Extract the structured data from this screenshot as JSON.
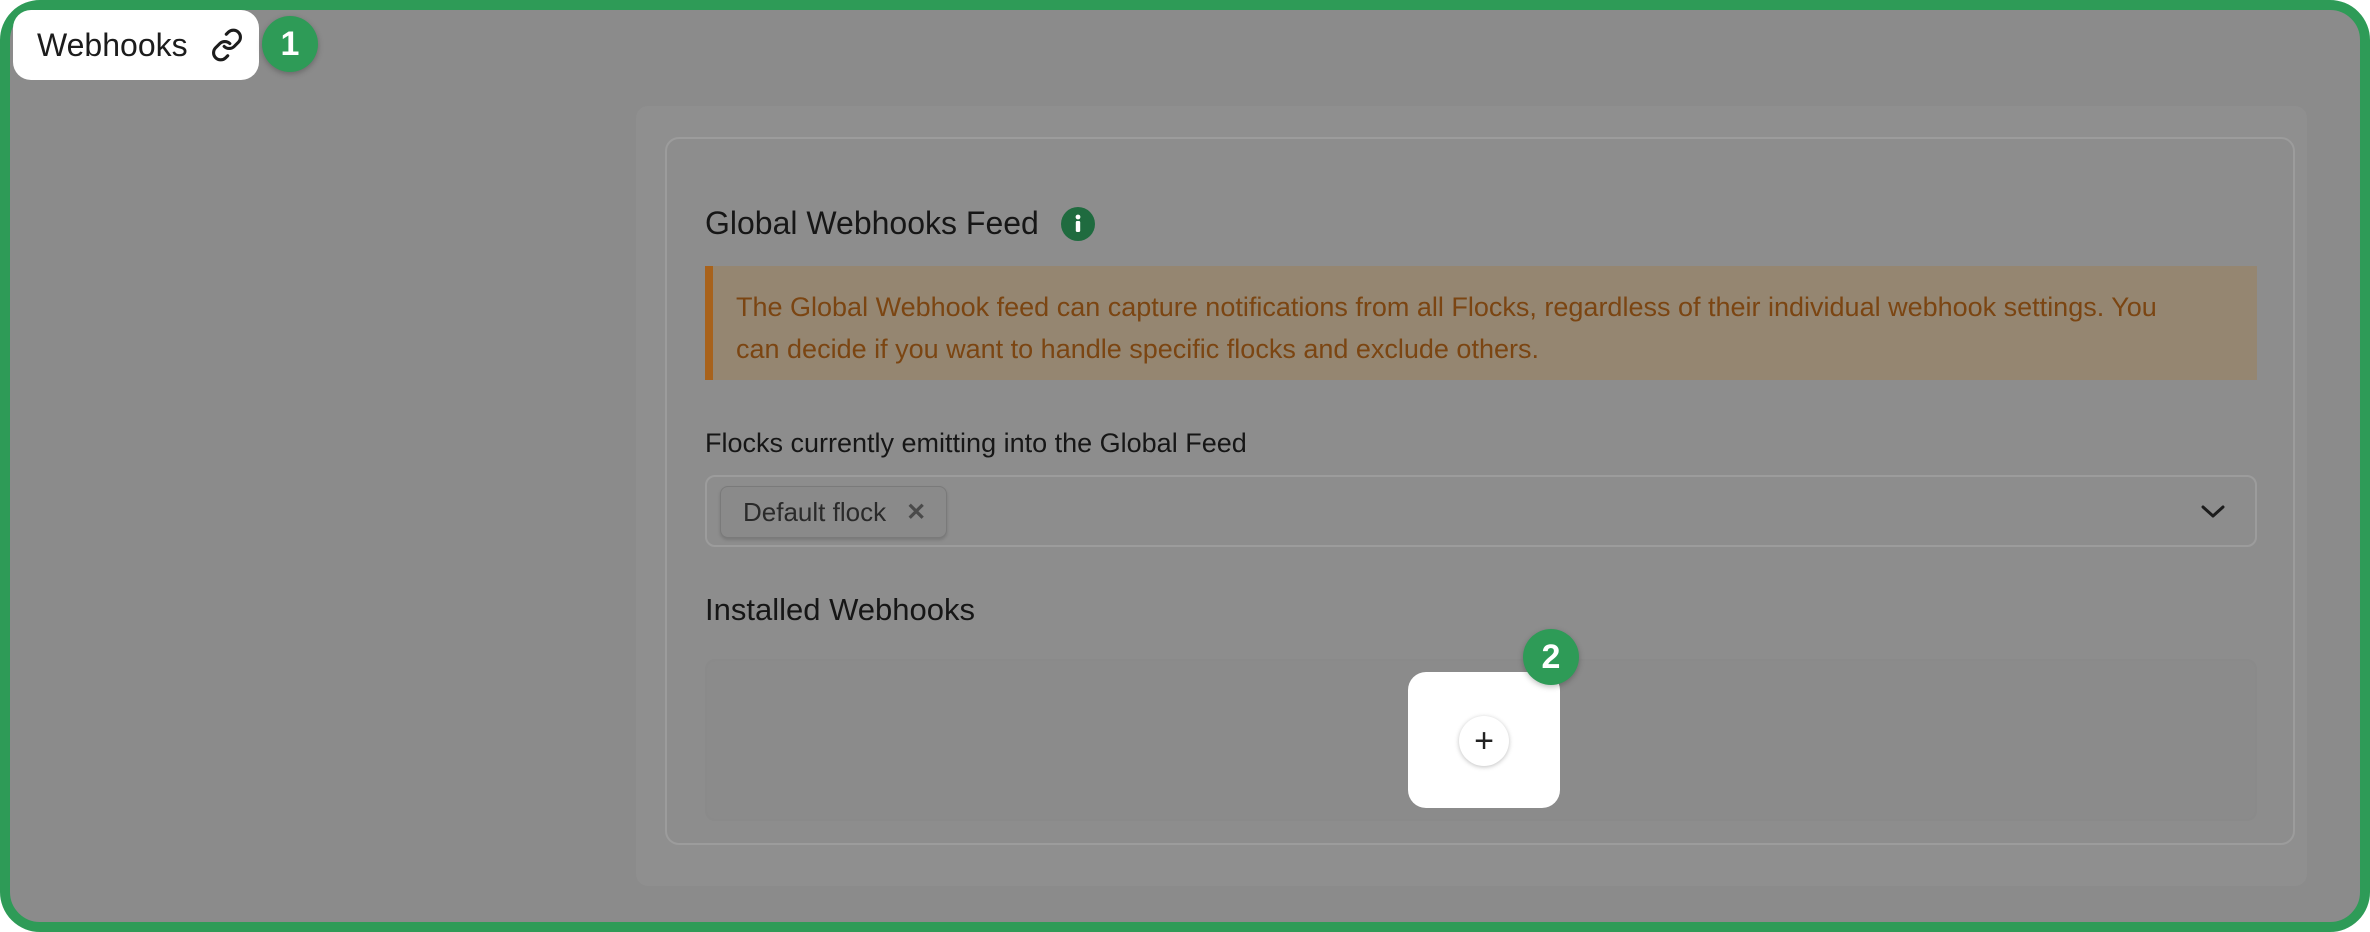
{
  "header": {
    "title": "Webhooks",
    "link_icon": "link-icon"
  },
  "badges": {
    "step1": "1",
    "step2": "2",
    "color": "#2e9b57"
  },
  "global_feed": {
    "heading": "Global Webhooks Feed",
    "info_icon": "info-icon",
    "notice_line1": "The Global Webhook feed can capture notifications from all Flocks, regardless of their individual webhook settings. You",
    "notice_line2": "can decide if you want to handle specific flocks and exclude others.",
    "emitting_label": "Flocks currently emitting into the Global Feed",
    "selected_flocks": [
      {
        "label": "Default flock",
        "remove_icon": "close-icon"
      }
    ],
    "dropdown_icon": "chevron-down-icon"
  },
  "installed": {
    "heading": "Installed Webhooks",
    "add_symbol": "+"
  },
  "colors": {
    "frame": "#2e9b57",
    "overlay": "#8b8b8b",
    "notice_border": "#a8621b",
    "notice_text": "#7b4512",
    "info_badge": "#1f6b3f"
  }
}
